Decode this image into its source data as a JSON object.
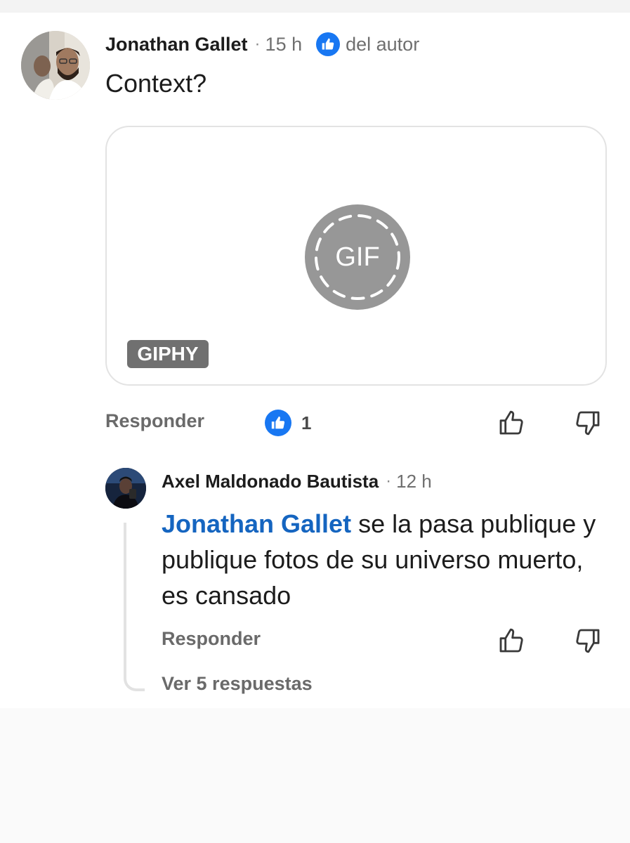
{
  "comment": {
    "author": "Jonathan Gallet",
    "separator": "·",
    "time": "15 h",
    "author_badge": "del autor",
    "text": "Context?",
    "gif": {
      "center_label": "GIF",
      "provider": "GIPHY"
    },
    "reply_label": "Responder",
    "reaction_count": "1"
  },
  "reply": {
    "author": "Axel Maldonado Bautista",
    "separator": "·",
    "time": "12 h",
    "mention": "Jonathan Gallet",
    "text": " se la pasa publique y publique fotos de su universo muerto, es cansado",
    "reply_label": "Responder",
    "view_replies": "Ver 5 respuestas"
  },
  "colors": {
    "accent_blue": "#1877f2",
    "mention_blue": "#1565c0",
    "muted_text": "#6a6a6a"
  },
  "icons": [
    "thumbs-up-icon",
    "thumbs-down-icon",
    "like-reaction-icon",
    "gif-placeholder-icon"
  ]
}
